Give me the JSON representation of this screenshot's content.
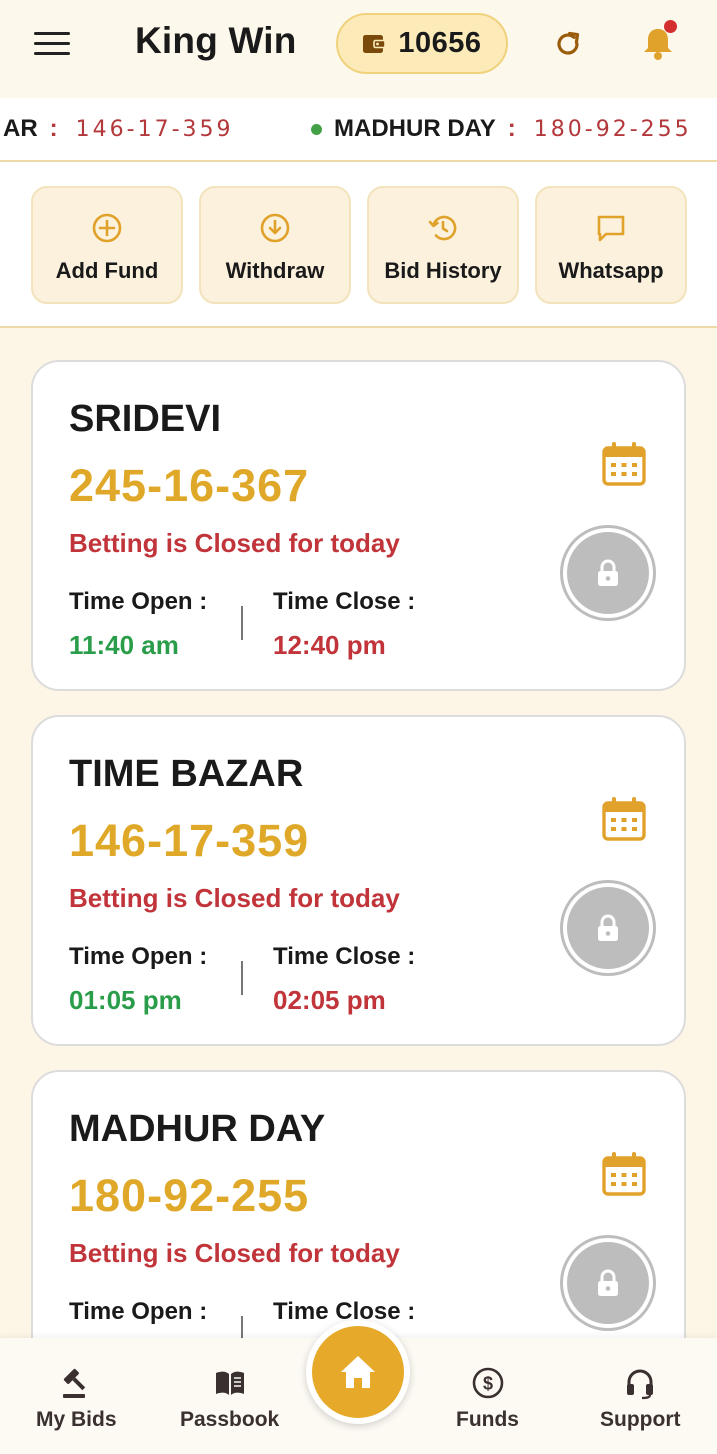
{
  "header": {
    "title": "King Win",
    "wallet_amount": "10656"
  },
  "ticker": [
    {
      "name": "AR",
      "value": "146-17-359",
      "dot": false
    },
    {
      "name": "MADHUR DAY",
      "value": "180-92-255",
      "dot": true
    }
  ],
  "ticker_separator": ":",
  "actions": [
    {
      "label": "Add Fund",
      "icon": "add-circle-icon"
    },
    {
      "label": "Withdraw",
      "icon": "download-circle-icon"
    },
    {
      "label": "Bid History",
      "icon": "history-icon"
    },
    {
      "label": "Whatsapp",
      "icon": "chat-icon"
    }
  ],
  "games": [
    {
      "name": "SRIDEVI",
      "result": "245-16-367",
      "status": "Betting is Closed for today",
      "open_label": "Time Open :",
      "open_time": "11:40 am",
      "close_label": "Time Close :",
      "close_time": "12:40 pm"
    },
    {
      "name": "TIME BAZAR",
      "result": "146-17-359",
      "status": "Betting is Closed for today",
      "open_label": "Time Open :",
      "open_time": "01:05 pm",
      "close_label": "Time Close :",
      "close_time": "02:05 pm"
    },
    {
      "name": "MADHUR DAY",
      "result": "180-92-255",
      "status": "Betting is Closed for today",
      "open_label": "Time Open :",
      "open_time": "",
      "close_label": "Time Close :",
      "close_time": ""
    }
  ],
  "bottom_nav": [
    {
      "label": "My Bids",
      "icon": "gavel-icon"
    },
    {
      "label": "Passbook",
      "icon": "book-icon"
    },
    {
      "label": "Funds",
      "icon": "dollar-icon"
    },
    {
      "label": "Support",
      "icon": "headset-icon"
    }
  ],
  "colors": {
    "accent": "#e7a92a",
    "result": "#e0a828",
    "closed": "#c0343a",
    "open_time": "#2a9d4a",
    "background": "#fdf6e6"
  }
}
